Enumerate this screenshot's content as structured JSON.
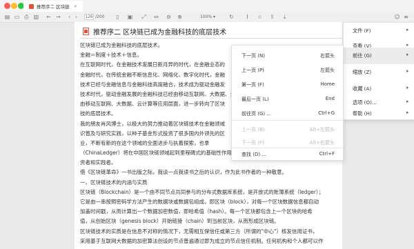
{
  "window": {
    "tab_title": "推荐序二 区块链",
    "tab_close": "×"
  },
  "toolbar": {
    "page_current": "126",
    "page_total": "/200",
    "zoom": "100% ▾"
  },
  "document": {
    "heading": "推荐序二 区块链已成为金融科技的底层技术",
    "lines": [
      "区块链已成为金融科技的底层技术。",
      "金融＝制度＋技术＋信息。",
      "在互联网时代，在金融技术发展日新月异的时代，在金融业态的",
      "金融时代，在传统金融不断信息化、网络化、数字化时代，金融",
      "技术已经与金融信息与金融科技高度融合，技术成为驱动金融发",
      "技术时代，驱动金融发展的金融科技已经由移动互联网、大数据、云",
      "由移动互联网、大数据、云计算等应用层面，进一步转向了区块",
      "技的底层技术。",
      "我的朋友肖风博士，以极大的努力推动着区块链技术在金融领域",
      "识普及与研究实践，以种子基金形式投资了很多国内外领先的区",
      "业，不断有新的在这个领域的全面进步与执着探索，也拿",
      "（ChinaLedger）将在中国区块链领域起到里程碑式的基础性作用",
      "资者和实践者。",
      "借《区块链革命》一书出版之际，我谈一点我读书之后的认识，作为此书作者的一种敬意。",
      "一、区块链技术的内涵与实质",
      "区块链（Blockchain）是一个由不同节点共同参与的分布式数据库系统，是开放式的账簿系统（ledger）；",
      "它是由一串按照密码学方法产生的数据块或数据包组成，即区块（block），对每一个区块数据信息都自动",
      "加盖时间戳，从而计算出一个数据加密数值，即哈希值（hash）。每一个区块都包含上一个区块的哈希",
      "值，从创始区块（genesis block）开始链接（chain）到当前区块，从而形成区块链。",
      "区块链技术的实质是在信息不对称的情况下，无需相互保信任或第三方（所谓的\"中心\"）核发信用证书，",
      "采用基于互联网大数据的加密算法创设的节点普遍通过即为成立的节点信任机制。任何机构和个人都可以作"
    ]
  },
  "menu": {
    "items": [
      {
        "label": "文件 (F)",
        "arrow": "▸"
      },
      {
        "label": "查看 (V)",
        "arrow": "▸"
      },
      {
        "label": "前往 (G)",
        "arrow": "▸"
      },
      {
        "label": "缩放 (Z)",
        "arrow": "▸"
      },
      {
        "label": "收藏 (A)",
        "arrow": "▸"
      },
      {
        "label": "选项 (O)...",
        "arrow": "▸"
      },
      {
        "label": "帮助 (H)",
        "arrow": "▸"
      }
    ]
  },
  "submenu": {
    "items": [
      {
        "label": "下一页 (N)",
        "shortcut": "右箭头"
      },
      {
        "label": "上一页 (P)",
        "shortcut": "左箭头"
      },
      {
        "label": "第一页 (F)",
        "shortcut": "Home"
      },
      {
        "label": "最后一页 (L)",
        "shortcut": "End"
      },
      {
        "label": "前往页 (G) ...",
        "shortcut": "Ctrl+G"
      },
      {
        "label": "上一页 (B)",
        "shortcut": "Alt+左箭头"
      },
      {
        "label": "下一页 (F)",
        "shortcut": "Alt+右箭头"
      },
      {
        "label": "查找 (D) ...",
        "shortcut": "Ctrl+F"
      }
    ]
  },
  "colors": {
    "accent": "#e0523c",
    "menu_highlight": "#ececec"
  }
}
